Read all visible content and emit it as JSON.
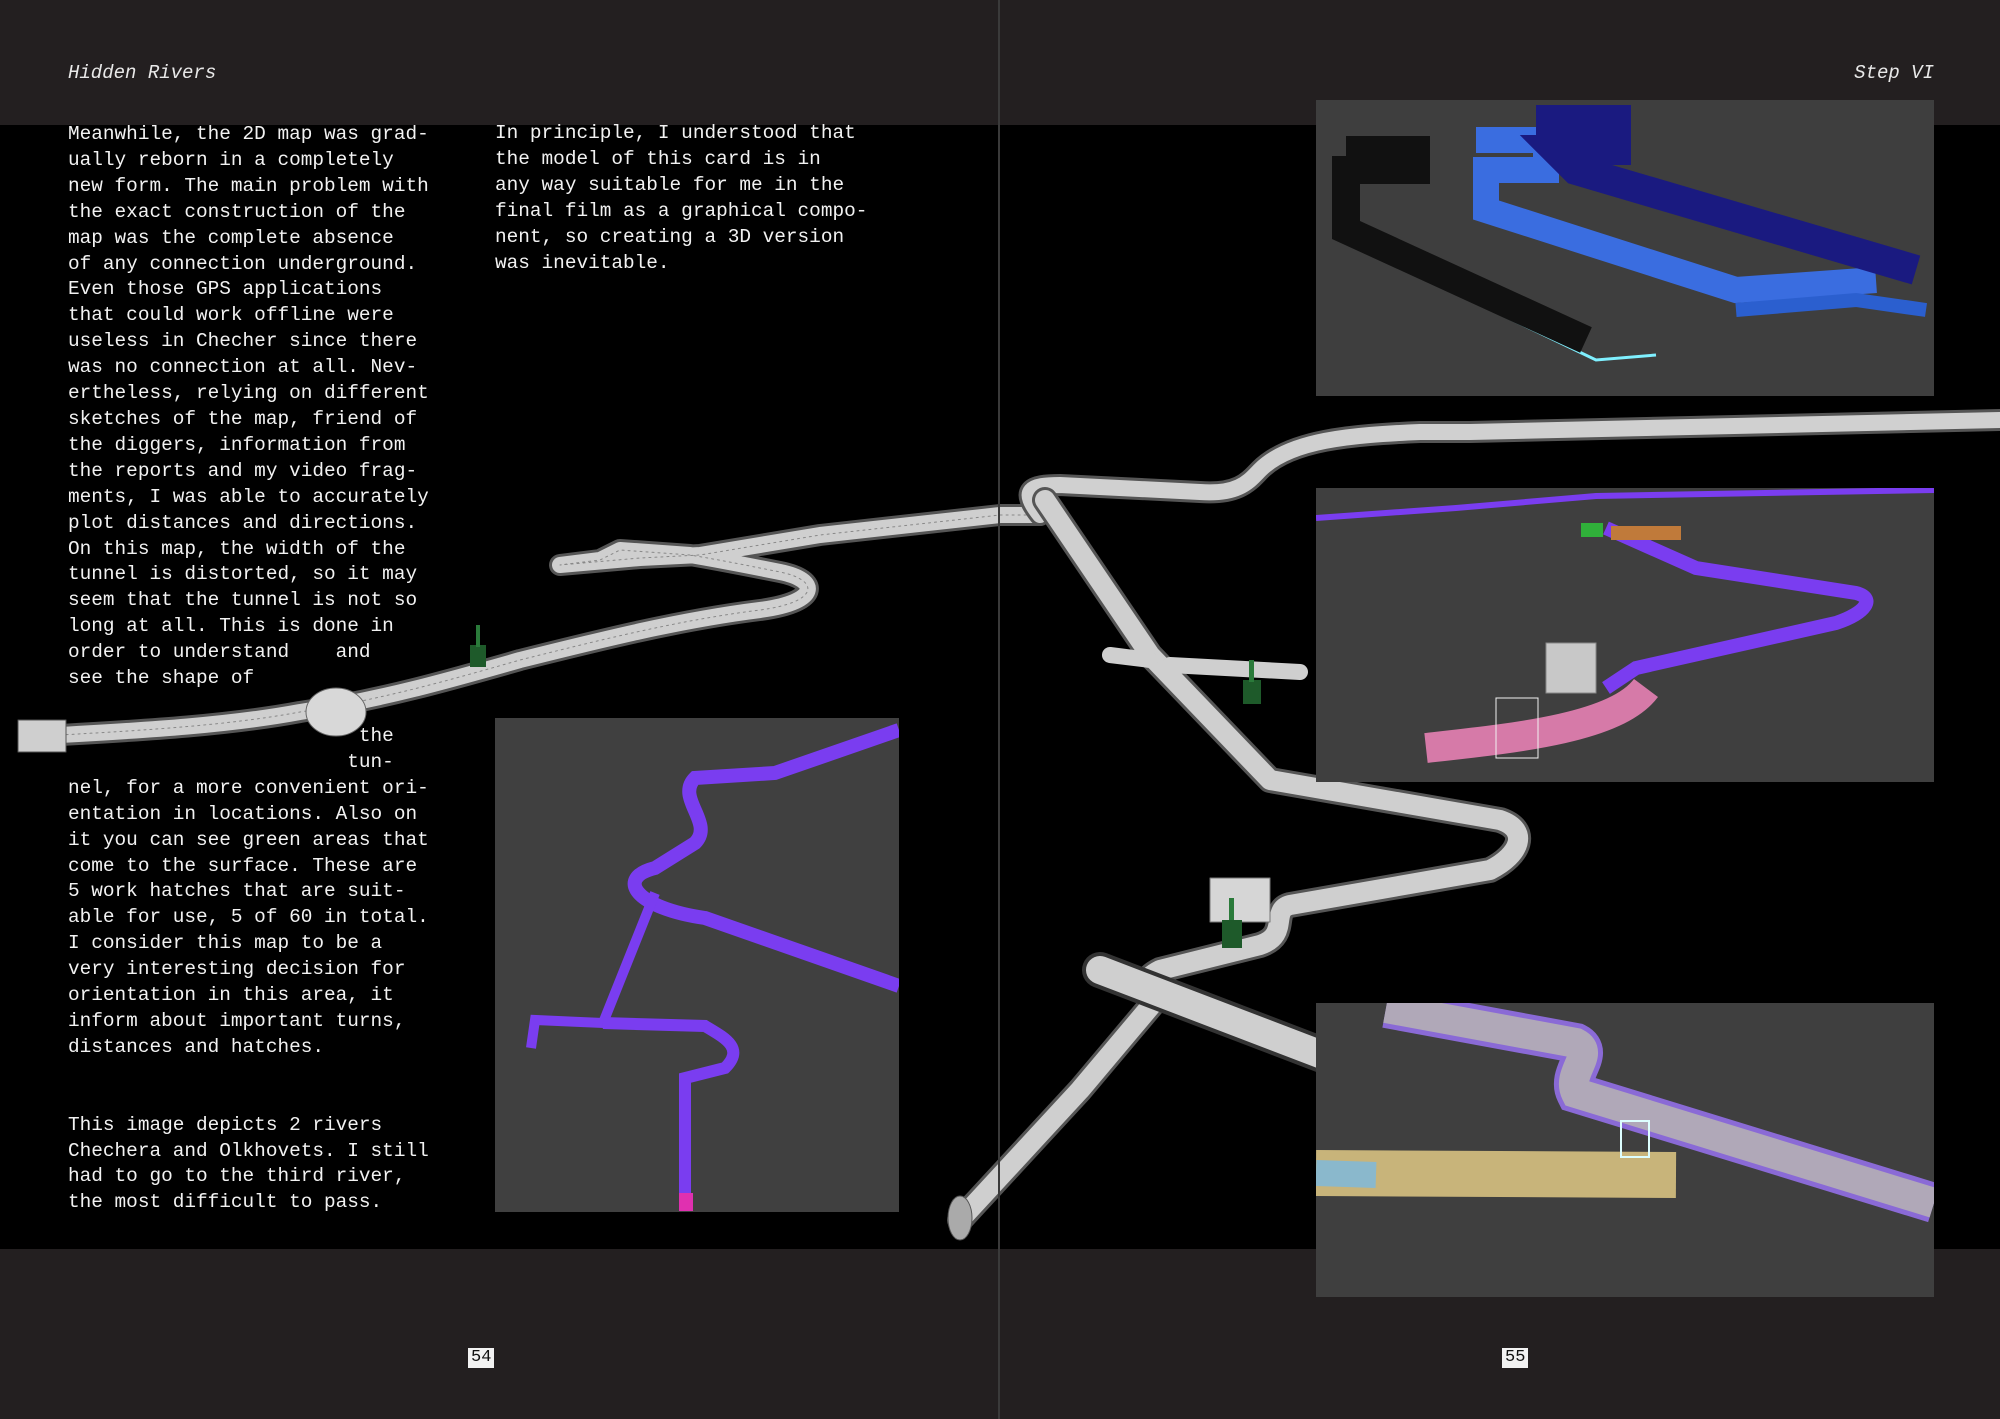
{
  "spread": {
    "left_header": "Hidden Rivers",
    "right_header": "Step VI",
    "left_page_number": "54",
    "right_page_number": "55"
  },
  "column_left_a": {
    "lines": [
      "Meanwhile, the 2D map was grad-",
      "ually reborn in a completely",
      "new form. The main problem with",
      "the exact construction of the",
      "map was the complete absence",
      "of any connection underground.",
      "Even those GPS applications",
      "that could work offline were",
      "useless in Checher since there",
      "was no connection at all. Nev-",
      "ertheless, relying on different",
      "sketches of the map, friend of",
      "the diggers, information from",
      "the reports and my video frag-",
      "ments, I was able to accurately",
      "plot distances and directions.",
      "On this map, the width of the",
      "tunnel is distorted, so it may",
      "seem that the tunnel is not so",
      "long at all. This is done in",
      "order to understand    and",
      "see the shape of"
    ]
  },
  "column_left_b": {
    "lines": [
      "                         the",
      "                        tun-",
      "nel, for a more convenient ori-",
      "entation in locations. Also on",
      "it you can see green areas that",
      "come to the surface. These are",
      "5 work hatches that are suit-",
      "able for use, 5 of 60 in total.",
      "I consider this map to be a",
      "very interesting decision for",
      "orientation in this area, it",
      "inform about important turns,",
      "distances and hatches.",
      "",
      "",
      "This image depicts 2 rivers",
      "Chechera and Olkhovets. I still",
      "had to go to the third river,",
      "the most difficult to pass."
    ]
  },
  "column_right": {
    "lines": [
      "In principle, I understood that",
      "the model of this card is in",
      "any way suitable for me in the",
      "final film as a graphical compo-",
      "nent, so creating a 3D version",
      "was inevitable."
    ]
  },
  "colors": {
    "band": "#231f20",
    "page": "#000000",
    "panel": "#3d3d3d",
    "tunnel": "#bfbfbf",
    "hatch": "#1e5a2a",
    "wire_purple": "#7a3df0",
    "wire_cyan": "#7ff0ff",
    "wire_blue": "#3a6de0"
  },
  "icons": {
    "hatch": "green-hatch-icon"
  }
}
